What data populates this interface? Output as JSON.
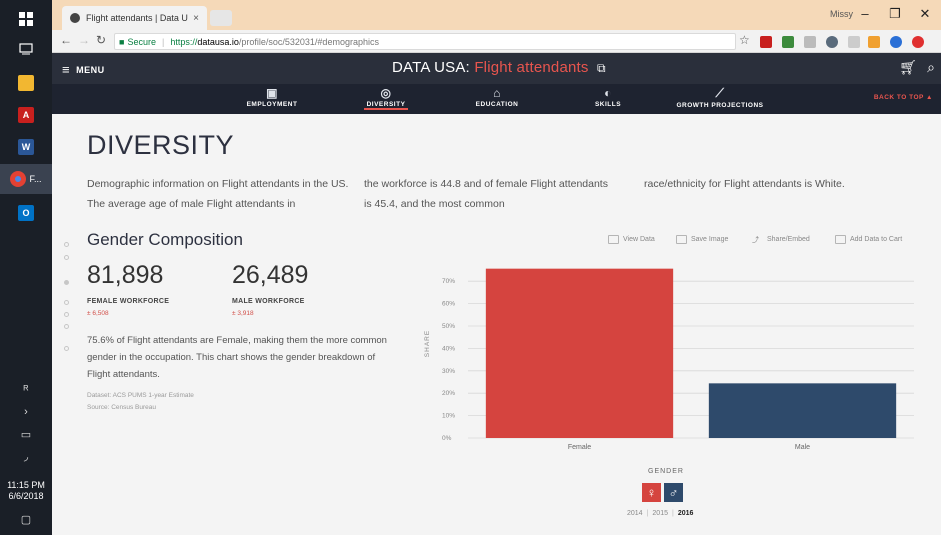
{
  "taskbar": {
    "clock_time": "11:15 PM",
    "clock_date": "6/6/2018",
    "chrome_label": "F..."
  },
  "browser": {
    "tab_title": "Flight attendants | Data U",
    "tab_close": "×",
    "window_user": "Missy",
    "window_controls": [
      "–",
      "❐",
      "✕"
    ],
    "secure_label": "Secure",
    "url_scheme": "https://",
    "url_host": "datausa.io",
    "url_path": "/profile/soc/532031/#demographics"
  },
  "site": {
    "menu_label": "MENU",
    "brand": "DATA USA:",
    "occupation": "Flight attendants",
    "nav": [
      {
        "label": "EMPLOYMENT",
        "icon": "briefcase-icon",
        "active": false
      },
      {
        "label": "DIVERSITY",
        "icon": "globe-icon",
        "active": true
      },
      {
        "label": "EDUCATION",
        "icon": "graduation-cap-icon",
        "active": false
      },
      {
        "label": "SKILLS",
        "icon": "lightbulb-icon",
        "active": false
      },
      {
        "label": "GROWTH PROJECTIONS",
        "icon": "line-chart-icon",
        "active": false
      }
    ],
    "back_to_top": "BACK TO TOP ▲"
  },
  "section": {
    "heading": "DIVERSITY",
    "intro_col1": "Demographic information on Flight attendants in the US. The average age of male Flight attendants in",
    "intro_col2": "the workforce is 44.8 and of female Flight attendants is 45.4, and the most common",
    "intro_col3": "race/ethnicity for Flight attendants is White."
  },
  "gender": {
    "heading": "Gender Composition",
    "female_value": "81,898",
    "female_label": "FEMALE WORKFORCE",
    "female_moe": "± 6,508",
    "male_value": "26,489",
    "male_label": "MALE WORKFORCE",
    "male_moe": "± 3,918",
    "description": "75.6% of Flight attendants are Female, making them the more common gender in the occupation. This chart shows the gender breakdown of Flight attendants.",
    "dataset": "Dataset: ACS PUMS 1-year Estimate",
    "source": "Source: Census Bureau",
    "tools": [
      "View Data",
      "Save Image",
      "Share/Embed",
      "Add Data to Cart"
    ],
    "legend_title": "GENDER",
    "years": [
      "2014",
      "2015",
      "2016"
    ],
    "selected_year": "2016"
  },
  "colors": {
    "female": "#d5443f",
    "male": "#2e4a6b",
    "accent": "#e8554e",
    "header": "#2a2f3b"
  },
  "chart_data": {
    "type": "bar",
    "categories": [
      "Female",
      "Male"
    ],
    "values": [
      75.6,
      24.4
    ],
    "ylabel": "SHARE",
    "xlabel": "",
    "ylim": [
      0,
      75
    ],
    "yticks": [
      "0%",
      "10%",
      "20%",
      "30%",
      "40%",
      "50%",
      "60%",
      "70%"
    ],
    "grid": true
  }
}
